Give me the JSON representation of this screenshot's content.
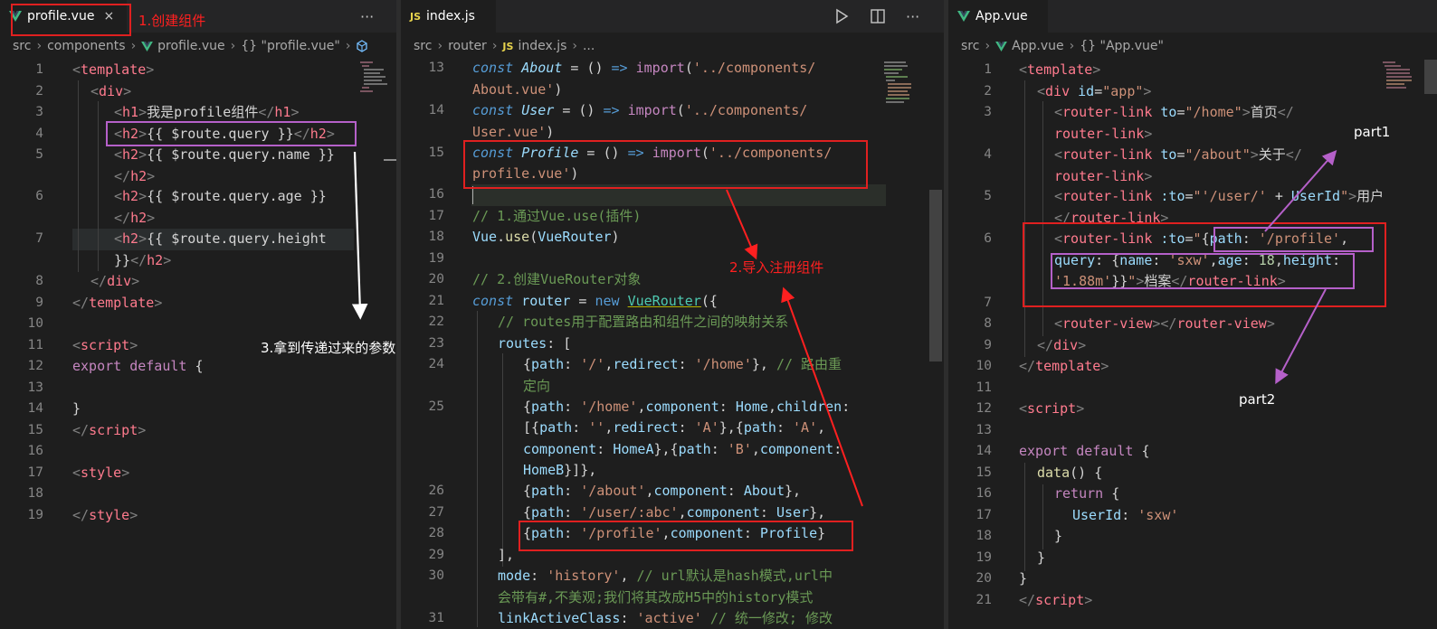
{
  "pane1": {
    "tab_label": "profile.vue",
    "tab_close": "×",
    "more": "···",
    "breadcrumb": [
      "src",
      "components",
      "profile.vue",
      "{} \"profile.vue\""
    ],
    "line_numbers": [
      "1",
      "2",
      "3",
      "4",
      "5",
      "",
      "6",
      "",
      "7",
      "",
      "8",
      "9",
      "10",
      "11",
      "12",
      "13",
      "14",
      "15",
      "16",
      "17",
      "18",
      "19"
    ]
  },
  "pane2": {
    "tab_label": "index.js",
    "tab_icon_text": "JS",
    "breadcrumb": [
      "src",
      "router",
      "index.js",
      "..."
    ],
    "line_numbers": [
      "13",
      "",
      "14",
      "",
      "15",
      "",
      "16",
      "17",
      "18",
      "19",
      "20",
      "21",
      "22",
      "23",
      "24",
      "",
      "25",
      "",
      "",
      "",
      "26",
      "27",
      "28",
      "29",
      "30",
      "",
      "31"
    ]
  },
  "pane3": {
    "tab_label": "App.vue",
    "breadcrumb": [
      "src",
      "App.vue",
      "{} \"App.vue\""
    ],
    "line_numbers": [
      "1",
      "2",
      "3",
      "",
      "4",
      "",
      "5",
      "",
      "6",
      "",
      "",
      "7",
      "8",
      "9",
      "10",
      "11",
      "12",
      "13",
      "14",
      "15",
      "16",
      "17",
      "18",
      "19",
      "20",
      "21"
    ]
  },
  "annotations": {
    "step1": "1.创建组件",
    "step2": "2.导入注册组件",
    "step3": "3.拿到传递过来的参数",
    "part1": "part1",
    "part2": "part2"
  },
  "colors": {
    "background": "#1e1e1e",
    "red_box": "#e02020",
    "purple_box": "#b560c9",
    "annotation_red": "#ff2020"
  }
}
